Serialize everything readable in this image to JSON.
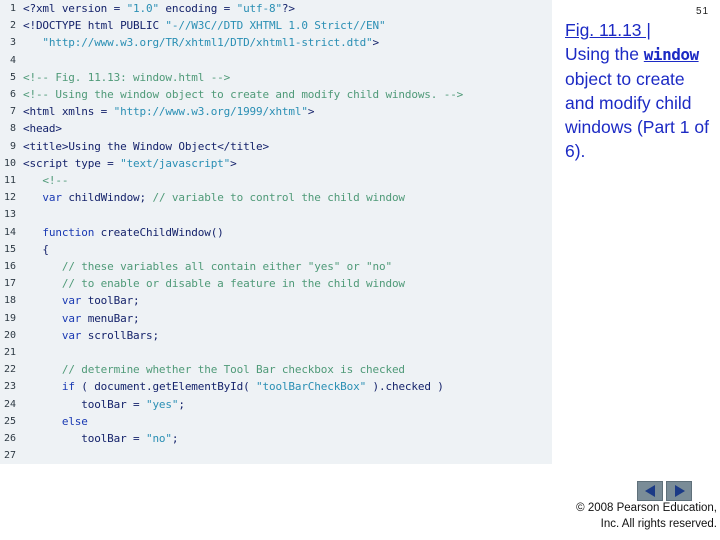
{
  "page_number": "51",
  "caption": {
    "fig_label": "Fig. 11.13 |",
    "text_before": "Using the ",
    "code_word": "window",
    "text_after": " object to create and modify child windows (Part 1 of 6)."
  },
  "copyright": {
    "line1": "© 2008 Pearson Education,",
    "line2": "Inc. All rights reserved."
  },
  "colors": {
    "code_bg": "#eef2f5",
    "code_default": "#15236b",
    "string": "#2a8fb4",
    "comment": "#4f9a78",
    "keyword": "#1a3ab3",
    "caption": "#1c2ac4"
  },
  "navigation": {
    "prev_icon": "triangle-left-icon",
    "next_icon": "triangle-right-icon"
  },
  "code_lines": [
    {
      "n": "1",
      "segments": [
        {
          "t": "<?xml version = ",
          "c": "default"
        },
        {
          "t": "\"1.0\"",
          "c": "string"
        },
        {
          "t": " encoding = ",
          "c": "default"
        },
        {
          "t": "\"utf-8\"",
          "c": "string"
        },
        {
          "t": "?>",
          "c": "default"
        }
      ]
    },
    {
      "n": "2",
      "segments": [
        {
          "t": "<!DOCTYPE html PUBLIC ",
          "c": "default"
        },
        {
          "t": "\"-//W3C//DTD XHTML 1.0 Strict//EN\"",
          "c": "string"
        }
      ]
    },
    {
      "n": "3",
      "segments": [
        {
          "t": "   ",
          "c": "default"
        },
        {
          "t": "\"http://www.w3.org/TR/xhtml1/DTD/xhtml1-strict.dtd\"",
          "c": "string"
        },
        {
          "t": ">",
          "c": "default"
        }
      ]
    },
    {
      "n": "4",
      "segments": []
    },
    {
      "n": "5",
      "segments": [
        {
          "t": "<!-- Fig. 11.13: window.html -->",
          "c": "comment"
        }
      ]
    },
    {
      "n": "6",
      "segments": [
        {
          "t": "<!-- Using the window object to create and modify child windows. -->",
          "c": "comment"
        }
      ]
    },
    {
      "n": "7",
      "segments": [
        {
          "t": "<html xmlns = ",
          "c": "default"
        },
        {
          "t": "\"http://www.w3.org/1999/xhtml\"",
          "c": "string"
        },
        {
          "t": ">",
          "c": "default"
        }
      ]
    },
    {
      "n": "8",
      "segments": [
        {
          "t": "<head>",
          "c": "default"
        }
      ]
    },
    {
      "n": "9",
      "segments": [
        {
          "t": "<title>",
          "c": "default"
        },
        {
          "t": "Using the Window Object",
          "c": "default"
        },
        {
          "t": "</title>",
          "c": "default"
        }
      ]
    },
    {
      "n": "10",
      "segments": [
        {
          "t": "<script type = ",
          "c": "default"
        },
        {
          "t": "\"text/javascript\"",
          "c": "string"
        },
        {
          "t": ">",
          "c": "default"
        }
      ]
    },
    {
      "n": "11",
      "segments": [
        {
          "t": "   ",
          "c": "default"
        },
        {
          "t": "<!--",
          "c": "comment"
        }
      ]
    },
    {
      "n": "12",
      "segments": [
        {
          "t": "   ",
          "c": "default"
        },
        {
          "t": "var",
          "c": "keyword"
        },
        {
          "t": " childWindow; ",
          "c": "default"
        },
        {
          "t": "// variable to control the child window",
          "c": "comment"
        }
      ]
    },
    {
      "n": "13",
      "segments": []
    },
    {
      "n": "14",
      "segments": [
        {
          "t": "   ",
          "c": "default"
        },
        {
          "t": "function",
          "c": "keyword"
        },
        {
          "t": " createChildWindow()",
          "c": "default"
        }
      ]
    },
    {
      "n": "15",
      "segments": [
        {
          "t": "   {",
          "c": "default"
        }
      ]
    },
    {
      "n": "16",
      "segments": [
        {
          "t": "      ",
          "c": "default"
        },
        {
          "t": "// these variables all contain either \"yes\" or \"no\"",
          "c": "comment"
        }
      ]
    },
    {
      "n": "17",
      "segments": [
        {
          "t": "      ",
          "c": "default"
        },
        {
          "t": "// to enable or disable a feature in the child window",
          "c": "comment"
        }
      ]
    },
    {
      "n": "18",
      "segments": [
        {
          "t": "      ",
          "c": "default"
        },
        {
          "t": "var",
          "c": "keyword"
        },
        {
          "t": " toolBar;",
          "c": "default"
        }
      ]
    },
    {
      "n": "19",
      "segments": [
        {
          "t": "      ",
          "c": "default"
        },
        {
          "t": "var",
          "c": "keyword"
        },
        {
          "t": " menuBar;",
          "c": "default"
        }
      ]
    },
    {
      "n": "20",
      "segments": [
        {
          "t": "      ",
          "c": "default"
        },
        {
          "t": "var",
          "c": "keyword"
        },
        {
          "t": " scrollBars;",
          "c": "default"
        }
      ]
    },
    {
      "n": "21",
      "segments": []
    },
    {
      "n": "22",
      "segments": [
        {
          "t": "      ",
          "c": "default"
        },
        {
          "t": "// determine whether the Tool Bar checkbox is checked",
          "c": "comment"
        }
      ]
    },
    {
      "n": "23",
      "segments": [
        {
          "t": "      ",
          "c": "default"
        },
        {
          "t": "if",
          "c": "keyword"
        },
        {
          "t": " ( document.getElementById( ",
          "c": "default"
        },
        {
          "t": "\"toolBarCheckBox\"",
          "c": "string"
        },
        {
          "t": " ).checked )",
          "c": "default"
        }
      ]
    },
    {
      "n": "24",
      "segments": [
        {
          "t": "         toolBar = ",
          "c": "default"
        },
        {
          "t": "\"yes\"",
          "c": "string"
        },
        {
          "t": ";",
          "c": "default"
        }
      ]
    },
    {
      "n": "25",
      "segments": [
        {
          "t": "      ",
          "c": "default"
        },
        {
          "t": "else",
          "c": "keyword"
        }
      ]
    },
    {
      "n": "26",
      "segments": [
        {
          "t": "         toolBar = ",
          "c": "default"
        },
        {
          "t": "\"no\"",
          "c": "string"
        },
        {
          "t": ";",
          "c": "default"
        }
      ]
    },
    {
      "n": "27",
      "segments": []
    }
  ]
}
